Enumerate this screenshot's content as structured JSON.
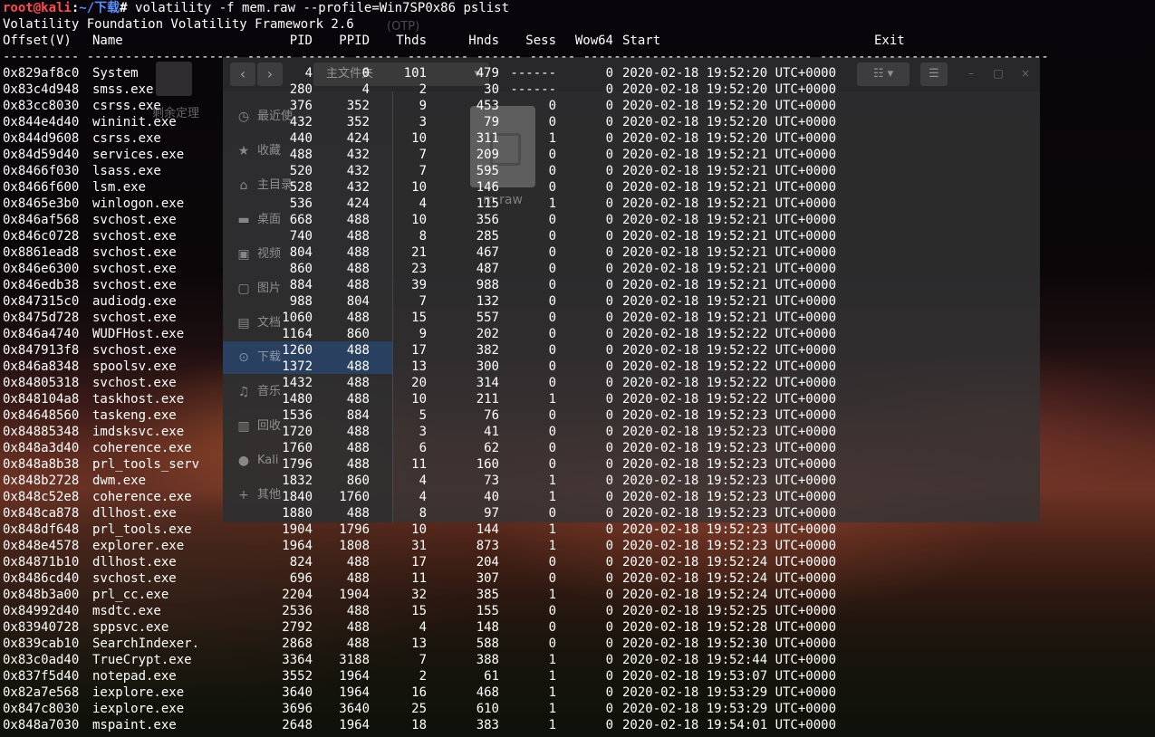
{
  "terminal": {
    "prompt": {
      "user_host": "root@kali",
      "separator": ":",
      "path": "~/下载",
      "symbol": "#",
      "command": " volatility -f mem.raw --profile=Win7SP0x86 pslist"
    },
    "banner": "Volatility Foundation Volatility Framework 2.6",
    "columns": {
      "offset": "Offset(V)",
      "name": "Name",
      "pid": "PID",
      "ppid": "PPID",
      "thds": "Thds",
      "hnds": "Hnds",
      "sess": "Sess",
      "wow64": "Wow64",
      "start": "Start",
      "exit": "Exit"
    },
    "separator_line": "---------- -------------------- ------ ------ ------ -------- ------ ------ ------------------------------ ------------------------------",
    "rows": [
      {
        "offset": "0x829af8c0",
        "name": "System",
        "pid": "4",
        "ppid": "0",
        "thds": "101",
        "hnds": "479",
        "sess": "------",
        "wow64": "0",
        "start": "2020-02-18 19:52:20 UTC+0000"
      },
      {
        "offset": "0x83c4d948",
        "name": "smss.exe",
        "pid": "280",
        "ppid": "4",
        "thds": "2",
        "hnds": "30",
        "sess": "------",
        "wow64": "0",
        "start": "2020-02-18 19:52:20 UTC+0000"
      },
      {
        "offset": "0x83cc8030",
        "name": "csrss.exe",
        "pid": "376",
        "ppid": "352",
        "thds": "9",
        "hnds": "453",
        "sess": "0",
        "wow64": "0",
        "start": "2020-02-18 19:52:20 UTC+0000"
      },
      {
        "offset": "0x844e4d40",
        "name": "wininit.exe",
        "pid": "432",
        "ppid": "352",
        "thds": "3",
        "hnds": "79",
        "sess": "0",
        "wow64": "0",
        "start": "2020-02-18 19:52:20 UTC+0000"
      },
      {
        "offset": "0x844d9608",
        "name": "csrss.exe",
        "pid": "440",
        "ppid": "424",
        "thds": "10",
        "hnds": "311",
        "sess": "1",
        "wow64": "0",
        "start": "2020-02-18 19:52:20 UTC+0000"
      },
      {
        "offset": "0x84d59d40",
        "name": "services.exe",
        "pid": "488",
        "ppid": "432",
        "thds": "7",
        "hnds": "209",
        "sess": "0",
        "wow64": "0",
        "start": "2020-02-18 19:52:21 UTC+0000"
      },
      {
        "offset": "0x8466f030",
        "name": "lsass.exe",
        "pid": "520",
        "ppid": "432",
        "thds": "7",
        "hnds": "595",
        "sess": "0",
        "wow64": "0",
        "start": "2020-02-18 19:52:21 UTC+0000"
      },
      {
        "offset": "0x8466f600",
        "name": "lsm.exe",
        "pid": "528",
        "ppid": "432",
        "thds": "10",
        "hnds": "146",
        "sess": "0",
        "wow64": "0",
        "start": "2020-02-18 19:52:21 UTC+0000"
      },
      {
        "offset": "0x8465e3b0",
        "name": "winlogon.exe",
        "pid": "536",
        "ppid": "424",
        "thds": "4",
        "hnds": "115",
        "sess": "1",
        "wow64": "0",
        "start": "2020-02-18 19:52:21 UTC+0000"
      },
      {
        "offset": "0x846af568",
        "name": "svchost.exe",
        "pid": "668",
        "ppid": "488",
        "thds": "10",
        "hnds": "356",
        "sess": "0",
        "wow64": "0",
        "start": "2020-02-18 19:52:21 UTC+0000"
      },
      {
        "offset": "0x846c0728",
        "name": "svchost.exe",
        "pid": "740",
        "ppid": "488",
        "thds": "8",
        "hnds": "285",
        "sess": "0",
        "wow64": "0",
        "start": "2020-02-18 19:52:21 UTC+0000"
      },
      {
        "offset": "0x8861ead8",
        "name": "svchost.exe",
        "pid": "804",
        "ppid": "488",
        "thds": "21",
        "hnds": "467",
        "sess": "0",
        "wow64": "0",
        "start": "2020-02-18 19:52:21 UTC+0000"
      },
      {
        "offset": "0x846e6300",
        "name": "svchost.exe",
        "pid": "860",
        "ppid": "488",
        "thds": "23",
        "hnds": "487",
        "sess": "0",
        "wow64": "0",
        "start": "2020-02-18 19:52:21 UTC+0000"
      },
      {
        "offset": "0x846edb38",
        "name": "svchost.exe",
        "pid": "884",
        "ppid": "488",
        "thds": "39",
        "hnds": "988",
        "sess": "0",
        "wow64": "0",
        "start": "2020-02-18 19:52:21 UTC+0000"
      },
      {
        "offset": "0x847315c0",
        "name": "audiodg.exe",
        "pid": "988",
        "ppid": "804",
        "thds": "7",
        "hnds": "132",
        "sess": "0",
        "wow64": "0",
        "start": "2020-02-18 19:52:21 UTC+0000"
      },
      {
        "offset": "0x8475d728",
        "name": "svchost.exe",
        "pid": "1060",
        "ppid": "488",
        "thds": "15",
        "hnds": "557",
        "sess": "0",
        "wow64": "0",
        "start": "2020-02-18 19:52:21 UTC+0000"
      },
      {
        "offset": "0x846a4740",
        "name": "WUDFHost.exe",
        "pid": "1164",
        "ppid": "860",
        "thds": "9",
        "hnds": "202",
        "sess": "0",
        "wow64": "0",
        "start": "2020-02-18 19:52:22 UTC+0000"
      },
      {
        "offset": "0x847913f8",
        "name": "svchost.exe",
        "pid": "1260",
        "ppid": "488",
        "thds": "17",
        "hnds": "382",
        "sess": "0",
        "wow64": "0",
        "start": "2020-02-18 19:52:22 UTC+0000"
      },
      {
        "offset": "0x846a8348",
        "name": "spoolsv.exe",
        "pid": "1372",
        "ppid": "488",
        "thds": "13",
        "hnds": "300",
        "sess": "0",
        "wow64": "0",
        "start": "2020-02-18 19:52:22 UTC+0000"
      },
      {
        "offset": "0x84805318",
        "name": "svchost.exe",
        "pid": "1432",
        "ppid": "488",
        "thds": "20",
        "hnds": "314",
        "sess": "0",
        "wow64": "0",
        "start": "2020-02-18 19:52:22 UTC+0000"
      },
      {
        "offset": "0x848104a8",
        "name": "taskhost.exe",
        "pid": "1480",
        "ppid": "488",
        "thds": "10",
        "hnds": "211",
        "sess": "1",
        "wow64": "0",
        "start": "2020-02-18 19:52:22 UTC+0000"
      },
      {
        "offset": "0x84648560",
        "name": "taskeng.exe",
        "pid": "1536",
        "ppid": "884",
        "thds": "5",
        "hnds": "76",
        "sess": "0",
        "wow64": "0",
        "start": "2020-02-18 19:52:23 UTC+0000"
      },
      {
        "offset": "0x84885348",
        "name": "imdsksvc.exe",
        "pid": "1720",
        "ppid": "488",
        "thds": "3",
        "hnds": "41",
        "sess": "0",
        "wow64": "0",
        "start": "2020-02-18 19:52:23 UTC+0000"
      },
      {
        "offset": "0x848a3d40",
        "name": "coherence.exe",
        "pid": "1760",
        "ppid": "488",
        "thds": "6",
        "hnds": "62",
        "sess": "0",
        "wow64": "0",
        "start": "2020-02-18 19:52:23 UTC+0000"
      },
      {
        "offset": "0x848a8b38",
        "name": "prl_tools_serv",
        "pid": "1796",
        "ppid": "488",
        "thds": "11",
        "hnds": "160",
        "sess": "0",
        "wow64": "0",
        "start": "2020-02-18 19:52:23 UTC+0000"
      },
      {
        "offset": "0x848b2728",
        "name": "dwm.exe",
        "pid": "1832",
        "ppid": "860",
        "thds": "4",
        "hnds": "73",
        "sess": "1",
        "wow64": "0",
        "start": "2020-02-18 19:52:23 UTC+0000"
      },
      {
        "offset": "0x848c52e8",
        "name": "coherence.exe",
        "pid": "1840",
        "ppid": "1760",
        "thds": "4",
        "hnds": "40",
        "sess": "1",
        "wow64": "0",
        "start": "2020-02-18 19:52:23 UTC+0000"
      },
      {
        "offset": "0x848ca878",
        "name": "dllhost.exe",
        "pid": "1880",
        "ppid": "488",
        "thds": "8",
        "hnds": "97",
        "sess": "0",
        "wow64": "0",
        "start": "2020-02-18 19:52:23 UTC+0000"
      },
      {
        "offset": "0x848df648",
        "name": "prl_tools.exe",
        "pid": "1904",
        "ppid": "1796",
        "thds": "10",
        "hnds": "144",
        "sess": "1",
        "wow64": "0",
        "start": "2020-02-18 19:52:23 UTC+0000"
      },
      {
        "offset": "0x848e4578",
        "name": "explorer.exe",
        "pid": "1964",
        "ppid": "1808",
        "thds": "31",
        "hnds": "873",
        "sess": "1",
        "wow64": "0",
        "start": "2020-02-18 19:52:23 UTC+0000"
      },
      {
        "offset": "0x84871b10",
        "name": "dllhost.exe",
        "pid": "824",
        "ppid": "488",
        "thds": "17",
        "hnds": "204",
        "sess": "0",
        "wow64": "0",
        "start": "2020-02-18 19:52:24 UTC+0000"
      },
      {
        "offset": "0x8486cd40",
        "name": "svchost.exe",
        "pid": "696",
        "ppid": "488",
        "thds": "11",
        "hnds": "307",
        "sess": "0",
        "wow64": "0",
        "start": "2020-02-18 19:52:24 UTC+0000"
      },
      {
        "offset": "0x848b3a00",
        "name": "prl_cc.exe",
        "pid": "2204",
        "ppid": "1904",
        "thds": "32",
        "hnds": "385",
        "sess": "1",
        "wow64": "0",
        "start": "2020-02-18 19:52:24 UTC+0000"
      },
      {
        "offset": "0x84992d40",
        "name": "msdtc.exe",
        "pid": "2536",
        "ppid": "488",
        "thds": "15",
        "hnds": "155",
        "sess": "0",
        "wow64": "0",
        "start": "2020-02-18 19:52:25 UTC+0000"
      },
      {
        "offset": "0x83940728",
        "name": "sppsvc.exe",
        "pid": "2792",
        "ppid": "488",
        "thds": "4",
        "hnds": "148",
        "sess": "0",
        "wow64": "0",
        "start": "2020-02-18 19:52:28 UTC+0000"
      },
      {
        "offset": "0x839cab10",
        "name": "SearchIndexer.",
        "pid": "2868",
        "ppid": "488",
        "thds": "13",
        "hnds": "588",
        "sess": "0",
        "wow64": "0",
        "start": "2020-02-18 19:52:30 UTC+0000"
      },
      {
        "offset": "0x83c0ad40",
        "name": "TrueCrypt.exe",
        "pid": "3364",
        "ppid": "3188",
        "thds": "7",
        "hnds": "388",
        "sess": "1",
        "wow64": "0",
        "start": "2020-02-18 19:52:44 UTC+0000"
      },
      {
        "offset": "0x837f5d40",
        "name": "notepad.exe",
        "pid": "3552",
        "ppid": "1964",
        "thds": "2",
        "hnds": "61",
        "sess": "1",
        "wow64": "0",
        "start": "2020-02-18 19:53:07 UTC+0000"
      },
      {
        "offset": "0x82a7e568",
        "name": "iexplore.exe",
        "pid": "3640",
        "ppid": "1964",
        "thds": "16",
        "hnds": "468",
        "sess": "1",
        "wow64": "0",
        "start": "2020-02-18 19:53:29 UTC+0000"
      },
      {
        "offset": "0x847c8030",
        "name": "iexplore.exe",
        "pid": "3696",
        "ppid": "3640",
        "thds": "25",
        "hnds": "610",
        "sess": "1",
        "wow64": "0",
        "start": "2020-02-18 19:53:29 UTC+0000"
      },
      {
        "offset": "0x848a7030",
        "name": "mspaint.exe",
        "pid": "2648",
        "ppid": "1964",
        "thds": "18",
        "hnds": "383",
        "sess": "1",
        "wow64": "0",
        "start": "2020-02-18 19:54:01 UTC+0000"
      }
    ]
  },
  "file_manager": {
    "path_label": "主文件夹",
    "path_arrow": "▾",
    "back_icon": "‹",
    "forward_icon": "›",
    "sidebar": [
      {
        "icon": "clock-icon",
        "glyph": "◷",
        "label": "最近使"
      },
      {
        "icon": "star-icon",
        "glyph": "★",
        "label": "收藏"
      },
      {
        "icon": "home-icon",
        "glyph": "⌂",
        "label": "主目录"
      },
      {
        "icon": "desktop-icon",
        "glyph": "▬",
        "label": "桌面"
      },
      {
        "icon": "video-icon",
        "glyph": "▣",
        "label": "视频"
      },
      {
        "icon": "picture-icon",
        "glyph": "▢",
        "label": "图片"
      },
      {
        "icon": "document-icon",
        "glyph": "▤",
        "label": "文档"
      },
      {
        "icon": "download-icon",
        "glyph": "⊙",
        "label": "下载"
      },
      {
        "icon": "music-icon",
        "glyph": "♫",
        "label": "音乐"
      },
      {
        "icon": "trash-icon",
        "glyph": "▥",
        "label": "回收"
      },
      {
        "icon": "kali-icon",
        "glyph": "●",
        "label": "Kali"
      },
      {
        "icon": "plus-icon",
        "glyph": "+",
        "label": "其他"
      }
    ],
    "active_sidebar_index": 7,
    "file_label": "m.raw",
    "view_icon": "☷",
    "view_arrow": "▾",
    "menu_icon": "☰",
    "minimize_icon": "–",
    "maximize_icon": "□",
    "close_icon": "×"
  },
  "desktop": {
    "doc_label": "剩余定理",
    "otp_label": "(OTP)"
  }
}
